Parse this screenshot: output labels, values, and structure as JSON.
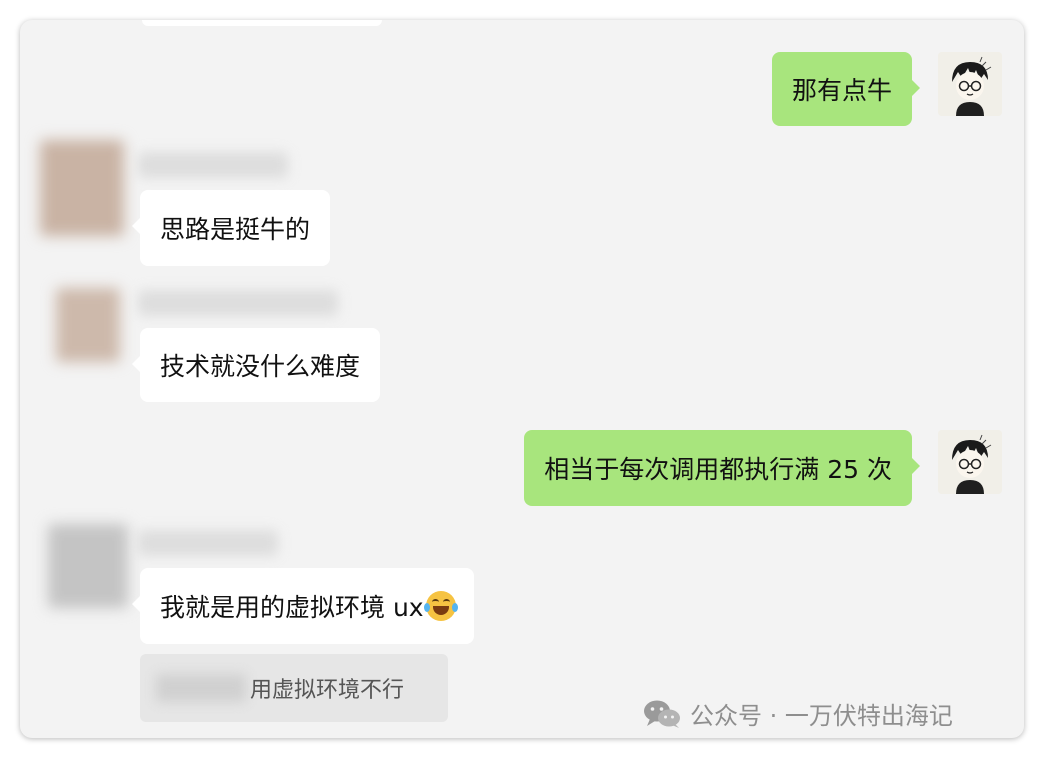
{
  "messages": [
    {
      "side": "out",
      "text": "那有点牛"
    },
    {
      "side": "in",
      "text": "思路是挺牛的"
    },
    {
      "side": "in",
      "text": "技术就没什么难度"
    },
    {
      "side": "out",
      "text": "相当于每次调用都执行满 25 次"
    },
    {
      "side": "in",
      "text": "我就是用的虚拟环境 ux",
      "emoji": "laugh-cry-emoji"
    }
  ],
  "quote": {
    "text": "用虚拟环境不行"
  },
  "watermark": {
    "text": "公众号 · 一万伏特出海记"
  },
  "colors": {
    "outgoing": "#a8e57d",
    "incoming": "#ffffff",
    "background": "#f3f3f3"
  }
}
